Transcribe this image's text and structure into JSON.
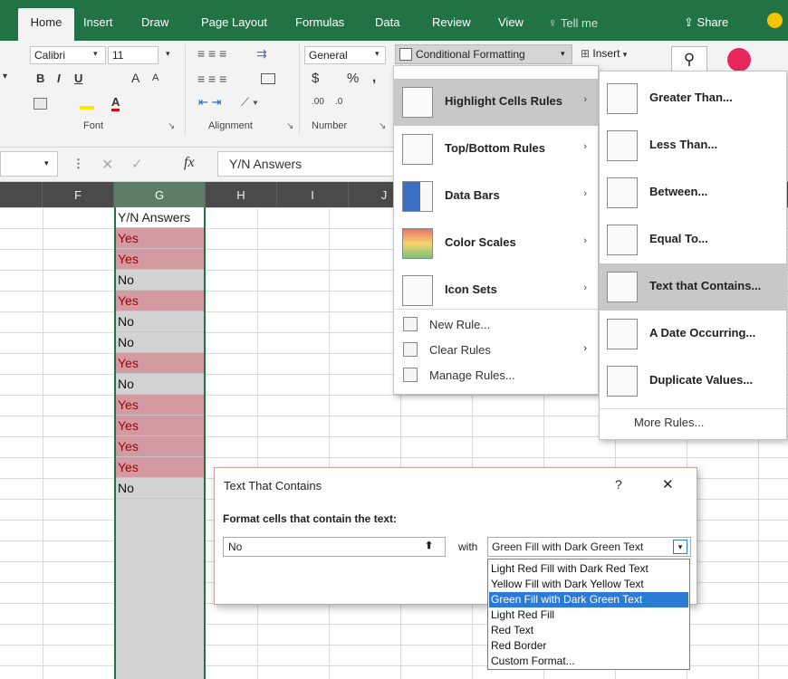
{
  "ribbon_tabs": {
    "home": "Home",
    "insert": "Insert",
    "draw": "Draw",
    "page_layout": "Page Layout",
    "formulas": "Formulas",
    "data": "Data",
    "review": "Review",
    "view": "View",
    "tell_me": "Tell me",
    "share": "Share"
  },
  "ribbon": {
    "font_name": "Calibri",
    "font_size": "11",
    "bold": "B",
    "italic": "I",
    "underline": "U",
    "grow_font": "A",
    "shrink_font": "A",
    "font_color": "A",
    "font_group": "Font",
    "alignment_group": "Alignment",
    "number_group": "Number",
    "number_format": "General",
    "currency": "$",
    "percent": "%",
    "comma": ",",
    "cf_button": "Conditional Formatting",
    "insert_button": "Insert"
  },
  "formula_bar": {
    "fx": "fx",
    "content": "Y/N Answers"
  },
  "columns": [
    "F",
    "G",
    "H",
    "I",
    "J"
  ],
  "column_g": {
    "header": "Y/N Answers",
    "cells": [
      {
        "text": "Yes",
        "highlight": true
      },
      {
        "text": "Yes",
        "highlight": true
      },
      {
        "text": "No",
        "highlight": false
      },
      {
        "text": "Yes",
        "highlight": true
      },
      {
        "text": "No",
        "highlight": false
      },
      {
        "text": "No",
        "highlight": false
      },
      {
        "text": "Yes",
        "highlight": true
      },
      {
        "text": "No",
        "highlight": false
      },
      {
        "text": "Yes",
        "highlight": true
      },
      {
        "text": "Yes",
        "highlight": true
      },
      {
        "text": "Yes",
        "highlight": true
      },
      {
        "text": "Yes",
        "highlight": true
      },
      {
        "text": "No",
        "highlight": false
      }
    ]
  },
  "cf_menu": {
    "items": [
      {
        "label": "Highlight Cells Rules",
        "icon": "highlight-cells-icon"
      },
      {
        "label": "Top/Bottom Rules",
        "icon": "top-bottom-icon"
      },
      {
        "label": "Data Bars",
        "icon": "data-bars-icon"
      },
      {
        "label": "Color Scales",
        "icon": "color-scales-icon"
      },
      {
        "label": "Icon Sets",
        "icon": "icon-sets-icon"
      }
    ],
    "small": [
      {
        "label": "New Rule...",
        "icon": "new-rule-icon"
      },
      {
        "label": "Clear Rules",
        "icon": "clear-rules-icon"
      },
      {
        "label": "Manage Rules...",
        "icon": "manage-rules-icon"
      }
    ]
  },
  "submenu": {
    "items": [
      {
        "label": "Greater Than..."
      },
      {
        "label": "Less Than..."
      },
      {
        "label": "Between..."
      },
      {
        "label": "Equal To..."
      },
      {
        "label": "Text that Contains..."
      },
      {
        "label": "A Date Occurring..."
      },
      {
        "label": "Duplicate Values..."
      }
    ],
    "more": "More Rules..."
  },
  "dialog": {
    "title": "Text That Contains",
    "help": "?",
    "close": "✕",
    "prompt": "Format cells that contain the text:",
    "input_value": "No",
    "with_label": "with",
    "selected_format": "Green Fill with Dark Green Text",
    "options": [
      "Light Red Fill with Dark Red Text",
      "Yellow Fill with Dark Yellow Text",
      "Green Fill with Dark Green Text",
      "Light Red Fill",
      "Red Text",
      "Red Border",
      "Custom Format..."
    ],
    "selected_index": 2
  },
  "colors": {
    "excel_green": "#217346",
    "highlight_fill": "#d49aa2",
    "highlight_text": "#9c0006",
    "menu_hover": "#c6c6c6",
    "selected_option": "#2a7bd5"
  }
}
